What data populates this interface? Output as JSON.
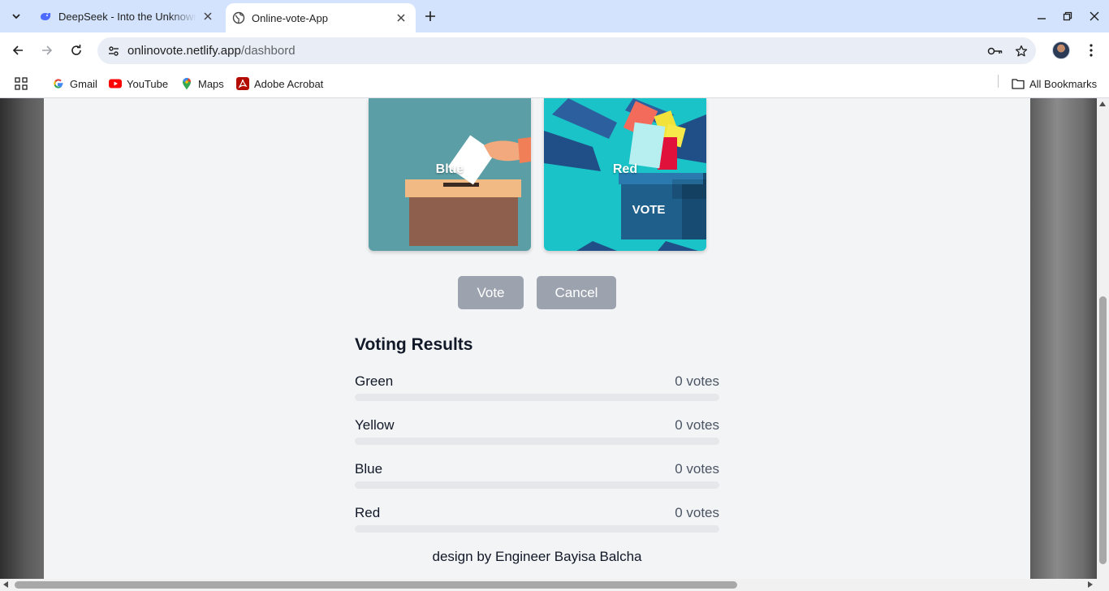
{
  "browser": {
    "tabs": [
      {
        "title": "DeepSeek - Into the Unknown",
        "active": false,
        "icon": "deepseek-whale-icon"
      },
      {
        "title": "Online-vote-App",
        "active": true,
        "icon": "globe-icon"
      }
    ],
    "url_host": "onlinovote.netlify.app",
    "url_path": "/dashbord",
    "bookmarks": [
      {
        "label": "Gmail",
        "icon": "google-g-icon"
      },
      {
        "label": "YouTube",
        "icon": "youtube-icon"
      },
      {
        "label": "Maps",
        "icon": "maps-pin-icon"
      },
      {
        "label": "Adobe Acrobat",
        "icon": "acrobat-icon"
      }
    ],
    "all_bookmarks": "All Bookmarks"
  },
  "candidates": [
    {
      "label": "Blue"
    },
    {
      "label": "Red",
      "image_text": "VOTE"
    }
  ],
  "actions": {
    "vote": "Vote",
    "cancel": "Cancel"
  },
  "results": {
    "title": "Voting Results",
    "items": [
      {
        "name": "Green",
        "votes": "0 votes",
        "fraction": 0
      },
      {
        "name": "Yellow",
        "votes": "0 votes",
        "fraction": 0
      },
      {
        "name": "Blue",
        "votes": "0 votes",
        "fraction": 0
      },
      {
        "name": "Red",
        "votes": "0 votes",
        "fraction": 0
      }
    ]
  },
  "footer": "design by Engineer Bayisa Balcha",
  "colors": {
    "button": "#9ca3af",
    "page_bg": "#f3f4f6",
    "bar_track": "#e5e7eb"
  }
}
